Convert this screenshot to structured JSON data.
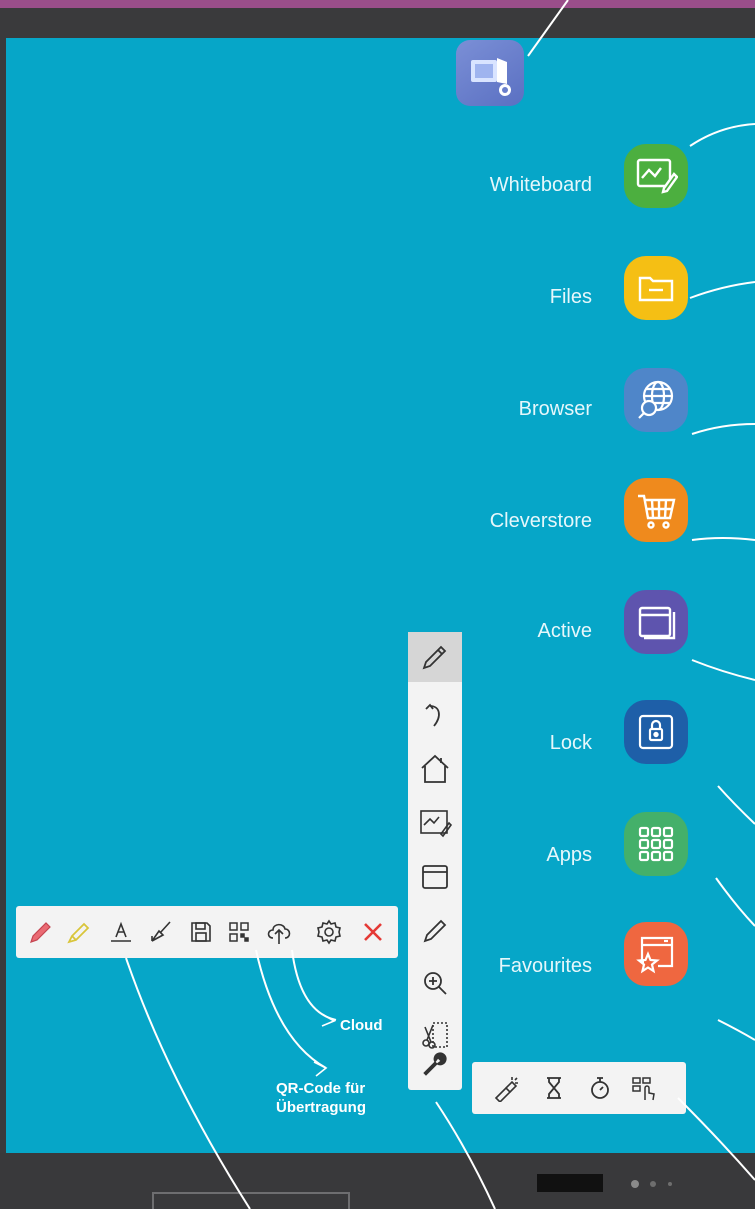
{
  "launcher": {
    "items": [
      {
        "label": "Whiteboard",
        "color": "#4caf3f",
        "icon": "whiteboard-icon"
      },
      {
        "label": "Files",
        "color": "#f5bf14",
        "icon": "folder-icon"
      },
      {
        "label": "Browser",
        "color": "#4f86c9",
        "icon": "globe-search-icon"
      },
      {
        "label": "Cleverstore",
        "color": "#ef8a1d",
        "icon": "cart-icon"
      },
      {
        "label": "Active",
        "color": "#5e54ae",
        "icon": "windows-icon"
      },
      {
        "label": "Lock",
        "color": "#1e5fa8",
        "icon": "lock-icon"
      },
      {
        "label": "Apps",
        "color": "#44b06a",
        "icon": "grid-icon"
      },
      {
        "label": "Favourites",
        "color": "#ef6740",
        "icon": "star-window-icon"
      }
    ]
  },
  "side_button": {
    "icon": "screen-share-icon",
    "color": "#6a7fcc"
  },
  "vertical_toolbar": {
    "tools": [
      "pencil-icon",
      "undo-icon",
      "home-icon",
      "whiteboard-icon",
      "window-icon",
      "pen-icon",
      "zoom-icon",
      "snip-icon",
      "wrench-icon"
    ],
    "active": "pencil-icon"
  },
  "horizontal_toolbar": {
    "tools": [
      "red-pen-icon",
      "highlighter-icon",
      "text-icon",
      "brush-icon",
      "save-icon",
      "qr-icon",
      "cloud-upload-icon",
      "gear-icon",
      "close-icon"
    ]
  },
  "small_toolbar": {
    "tools": [
      "spotlight-icon",
      "hourglass-icon",
      "stopwatch-icon",
      "vote-icon"
    ]
  },
  "callouts": {
    "cloud": "Cloud",
    "qr_line1": "QR-Code für",
    "qr_line2": "Übertragung"
  },
  "colors": {
    "screen": "#06a6c8",
    "bezel": "#3a3a3c",
    "toolbar": "#f3f3f3",
    "accent_red": "#e53935"
  }
}
